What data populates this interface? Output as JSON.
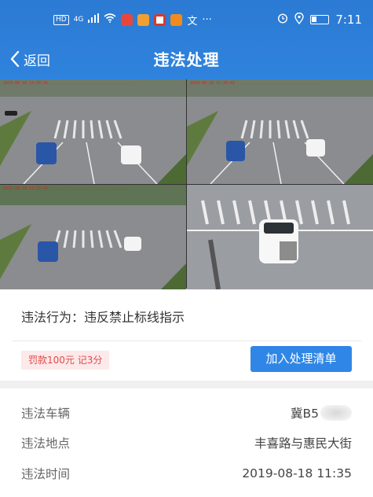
{
  "statusbar": {
    "network": "4G",
    "hd": "HD",
    "time": "7:11"
  },
  "nav": {
    "back_label": "返回",
    "title": "违法处理"
  },
  "violation": {
    "behavior": "违法行为：违反禁止标线指示",
    "penalty": "罚款100元 记3分",
    "add_button": "加入处理清单"
  },
  "details": {
    "vehicle_label": "违法车辆",
    "vehicle_value": "冀B5",
    "location_label": "违法地点",
    "location_value": "丰喜路与惠民大街",
    "time_label": "违法时间",
    "time_value": "2019-08-18 11:35"
  },
  "colors": {
    "header": "#2b7ad3",
    "button": "#2f86e6",
    "penalty_text": "#e04a4a",
    "penalty_bg": "#fde9e9"
  }
}
